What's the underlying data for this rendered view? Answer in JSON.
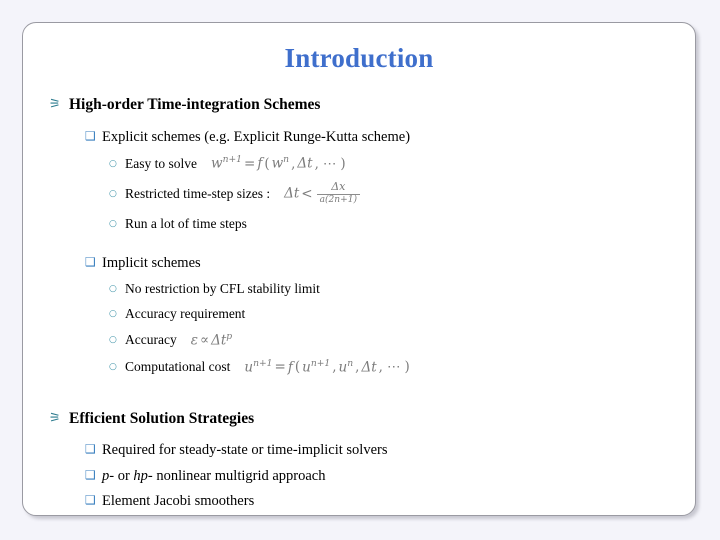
{
  "slide": {
    "title": "Introduction",
    "title_color": "#3f6fcc",
    "background_color": "#ffffff",
    "page_background_color": "#f4f4fa",
    "bullets": {
      "ornament": "⚞",
      "square": "❑",
      "circle": "○"
    },
    "sections": [
      {
        "heading": "High-order Time-integration Schemes",
        "groups": [
          {
            "label": "Explicit schemes (e.g. Explicit Runge-Kutta scheme)",
            "items": [
              {
                "text": "Easy to solve",
                "formula": "w^{n+1} = f(w^n, Δt, ⋯)"
              },
              {
                "text": "Restricted time-step sizes :",
                "formula": "Δt < Δx / (a(2n+1))"
              },
              {
                "text": "Run a lot of time steps",
                "formula": ""
              }
            ]
          },
          {
            "label": "Implicit schemes",
            "items": [
              {
                "text": "No restriction by CFL stability limit",
                "formula": ""
              },
              {
                "text": "Accuracy requirement",
                "formula": ""
              },
              {
                "text": "Accuracy",
                "formula": "ε ∝ Δt^p"
              },
              {
                "text": "Computational cost",
                "formula": "u^{n+1} = f(u^{n+1}, u^n, Δt, ⋯)"
              }
            ]
          }
        ]
      },
      {
        "heading": "Efficient Solution Strategies",
        "groups": [
          {
            "label": "Required for steady-state or time-implicit solvers",
            "items": []
          },
          {
            "label": "p- or hp- nonlinear multigrid approach",
            "items": []
          },
          {
            "label": "Element Jacobi smoothers",
            "items": []
          }
        ]
      }
    ]
  },
  "math_parts": {
    "f1": {
      "w": "w",
      "sup1": "n+1",
      "eq": "=",
      "f": "f",
      "open": "(",
      "w2": "w",
      "sup2": "n",
      "c1": ",",
      "dt": "Δt",
      "c2": ",",
      "dots": "⋯",
      "close": ")"
    },
    "f2": {
      "dt": "Δt",
      "lt": "<",
      "num": "Δx",
      "den": "a(2n+1)"
    },
    "f3": {
      "eps": "ε",
      "prop": "∝",
      "dt": "Δt",
      "sup": "p"
    },
    "f4": {
      "u": "u",
      "sup1": "n+1",
      "eq": "=",
      "f": "f",
      "open": "(",
      "u2": "u",
      "sup2": "n+1",
      "c1": ",",
      "u3": "u",
      "sup3": "n",
      "c2": ",",
      "dt": "Δt",
      "c3": ",",
      "dots": "⋯",
      "close": ")"
    }
  },
  "last_section_labels": {
    "l1_pre": "",
    "l2_a": "p",
    "l2_b": "- or ",
    "l2_c": "hp",
    "l2_d": "- nonlinear multigrid approach"
  }
}
